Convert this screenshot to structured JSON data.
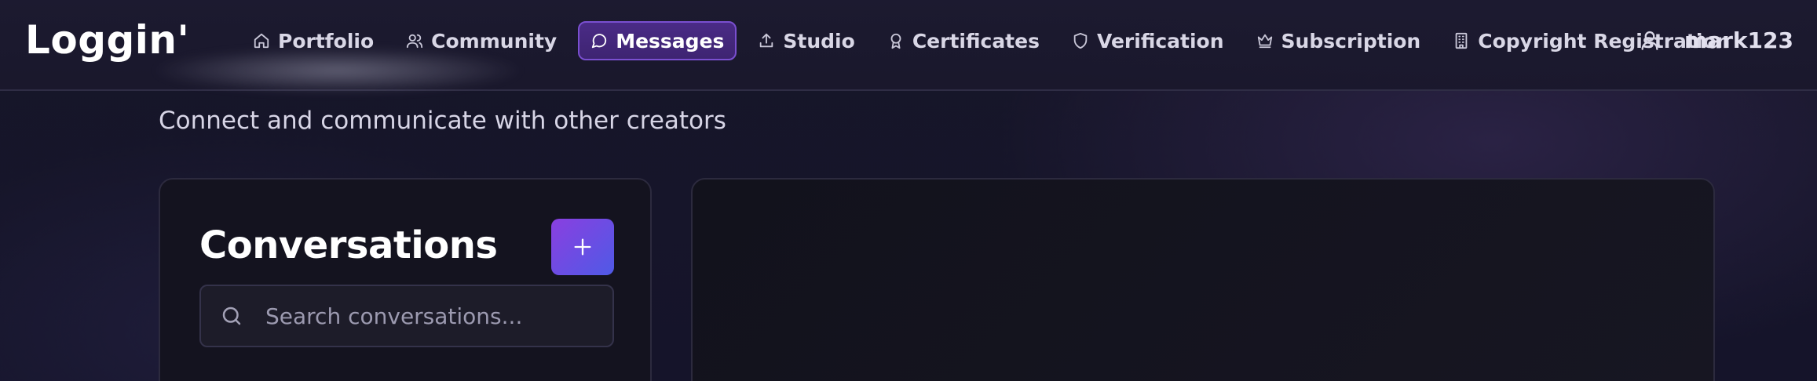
{
  "app": {
    "brand": "Loggin'"
  },
  "nav": {
    "items": [
      {
        "label": "Portfolio",
        "icon": "home-icon",
        "active": false
      },
      {
        "label": "Community",
        "icon": "users-icon",
        "active": false
      },
      {
        "label": "Messages",
        "icon": "message-circle-icon",
        "active": true
      },
      {
        "label": "Studio",
        "icon": "upload-icon",
        "active": false
      },
      {
        "label": "Certificates",
        "icon": "award-icon",
        "active": false
      },
      {
        "label": "Verification",
        "icon": "shield-icon",
        "active": false
      },
      {
        "label": "Subscription",
        "icon": "crown-icon",
        "active": false
      },
      {
        "label": "Copyright Registration",
        "icon": "building-icon",
        "active": false
      }
    ]
  },
  "user": {
    "name": "mark123",
    "icon": "user-icon"
  },
  "page": {
    "subtitle": "Connect and communicate with other creators"
  },
  "conversations": {
    "title": "Conversations",
    "add_button_icon": "plus-icon",
    "search_placeholder": "Search conversations...",
    "search_value": ""
  },
  "colors": {
    "accent_start": "#8a3fe0",
    "accent_end": "#4f5ae6",
    "active_nav_bg": "#4a2b86",
    "active_nav_border": "#7a4fd0"
  }
}
